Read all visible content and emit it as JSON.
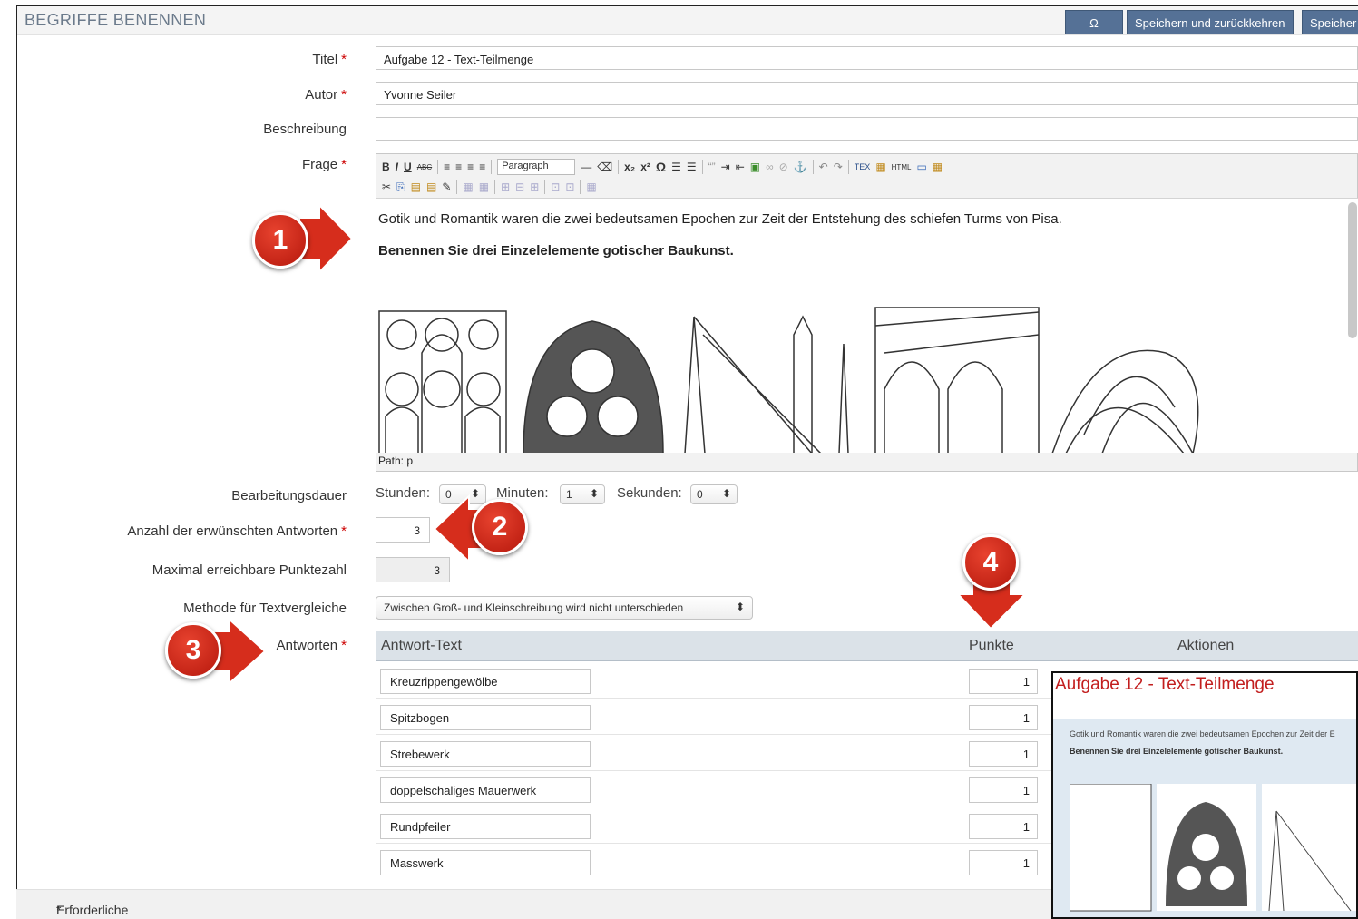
{
  "header": {
    "title": "BEGRIFFE BENENNEN",
    "omega_button": "Ω",
    "save_return_button": "Speichern und zurückkehren",
    "save_button": "Speicher"
  },
  "form": {
    "title_label": "Titel",
    "title_value": "Aufgabe 12 - Text-Teilmenge",
    "author_label": "Autor",
    "author_value": "Yvonne Seiler",
    "description_label": "Beschreibung",
    "description_value": "",
    "question_label": "Frage",
    "required_mark": "*"
  },
  "editor": {
    "format_select": "Paragraph",
    "paragraph_1": "Gotik und Romantik waren die zwei bedeutsamen Epochen zur Zeit der Entstehung des schiefen Turms von Pisa.",
    "paragraph_2": "Benennen Sie drei Einzelelemente gotischer Baukunst.",
    "path": "Path: p"
  },
  "duration": {
    "label": "Bearbeitungsdauer",
    "hours_label": "Stunden:",
    "hours_value": "0",
    "minutes_label": "Minuten:",
    "minutes_value": "1",
    "seconds_label": "Sekunden:",
    "seconds_value": "0"
  },
  "answers_count": {
    "label": "Anzahl der erwünschten Antworten",
    "value": "3"
  },
  "max_points": {
    "label": "Maximal erreichbare Punktezahl",
    "value": "3"
  },
  "method": {
    "label": "Methode für Textvergleiche",
    "value": "Zwischen Groß- und Kleinschreibung wird nicht unterschieden"
  },
  "answers": {
    "label": "Antworten",
    "col_text": "Antwort-Text",
    "col_points": "Punkte",
    "col_actions": "Aktionen",
    "rows": [
      {
        "text": "Kreuzrippengewölbe",
        "points": "1"
      },
      {
        "text": "Spitzbogen",
        "points": "1"
      },
      {
        "text": "Strebewerk",
        "points": "1"
      },
      {
        "text": "doppelschaliges Mauerwerk",
        "points": "1"
      },
      {
        "text": "Rundpfeiler",
        "points": "1"
      },
      {
        "text": "Masswerk",
        "points": "1"
      }
    ]
  },
  "footer": {
    "required_note": "Erforderliche Angabe"
  },
  "preview": {
    "title": "Aufgabe 12 - Text-Teilmenge",
    "line1": "Gotik und Romantik waren die zwei bedeutsamen Epochen zur Zeit der E",
    "line2": "Benennen Sie drei Einzelelemente gotischer Baukunst."
  },
  "callouts": [
    "1",
    "2",
    "3",
    "4"
  ],
  "colors": {
    "accent_button": "#557196",
    "required": "#cc0000",
    "callout_red": "#d62d1c",
    "preview_title": "#c21e1e"
  }
}
